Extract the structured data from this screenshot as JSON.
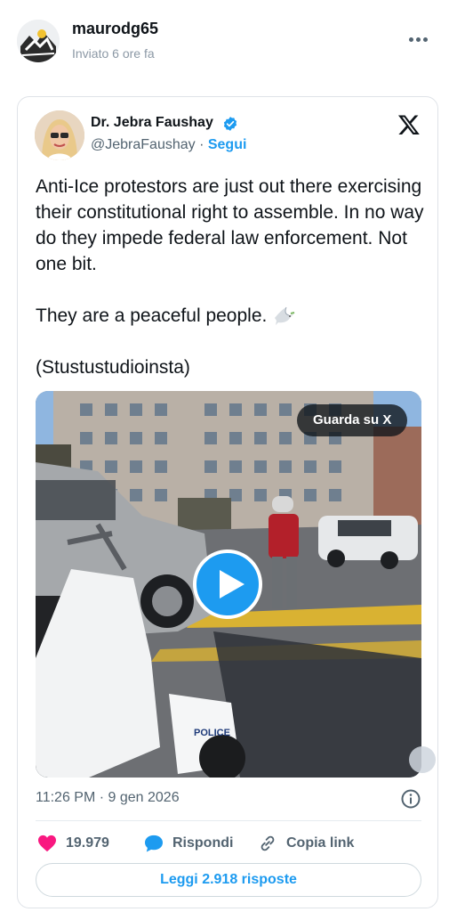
{
  "post": {
    "username": "maurodg65",
    "posted_label": "Inviato 6 ore fa"
  },
  "tweet": {
    "author_name": "Dr. Jebra Faushay",
    "handle": "@JebraFaushay",
    "separator": " · ",
    "follow_label": "Segui",
    "text_main": "Anti-Ice protestors are just out there exercising their constitutional right to assemble. In no way do they impede federal law enforcement. Not one bit.",
    "text_peaceful": "They are a peaceful people.",
    "text_credit": "(Stustustudioinsta)",
    "watch_label": "Guarda su X",
    "timestamp": "11:26 PM · 9 gen 2026",
    "likes": "19.979",
    "reply_label": "Rispondi",
    "copy_link_label": "Copia link",
    "read_replies_label": "Leggi 2.918 risposte"
  },
  "video_scene": {
    "police_label": "POLICE"
  },
  "colors": {
    "accent": "#1d9bf0",
    "like": "#f91880",
    "text": "#0f1419",
    "muted": "#536471"
  },
  "icons": [
    "more-options-icon",
    "verified-badge-icon",
    "x-logo-icon",
    "dove-icon",
    "play-icon",
    "info-icon",
    "heart-icon",
    "reply-icon",
    "link-icon"
  ]
}
